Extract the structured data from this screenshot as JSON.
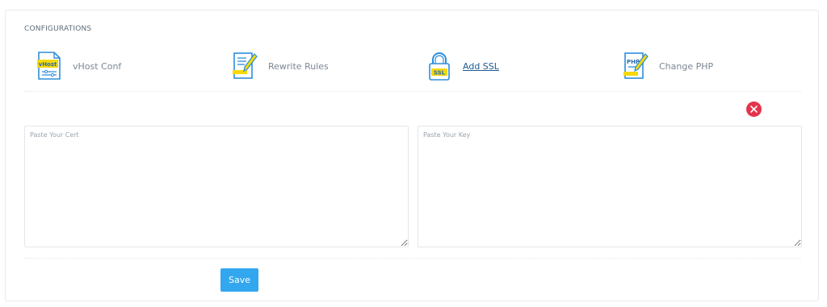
{
  "section": {
    "title": "CONFIGURATIONS"
  },
  "configs": [
    {
      "label": "vHost Conf",
      "icon": "vhost-file-icon",
      "icon_text": "vHost"
    },
    {
      "label": "Rewrite Rules",
      "icon": "rewrite-file-icon"
    },
    {
      "label": "Add SSL",
      "icon": "ssl-lock-icon",
      "icon_text": "SSL",
      "active": true
    },
    {
      "label": "Change PHP",
      "icon": "php-file-icon",
      "icon_text": "PHP"
    }
  ],
  "close": {
    "icon": "close-icon"
  },
  "cert": {
    "placeholder": "Paste Your Cert",
    "value": ""
  },
  "key": {
    "placeholder": "Paste Your Key",
    "value": ""
  },
  "save": {
    "label": "Save"
  },
  "colors": {
    "accent": "#33a7ee",
    "danger": "#e5334b",
    "link": "#1e5a92",
    "icon_blue": "#2e8ddc",
    "icon_yellow": "#f5d90a"
  }
}
